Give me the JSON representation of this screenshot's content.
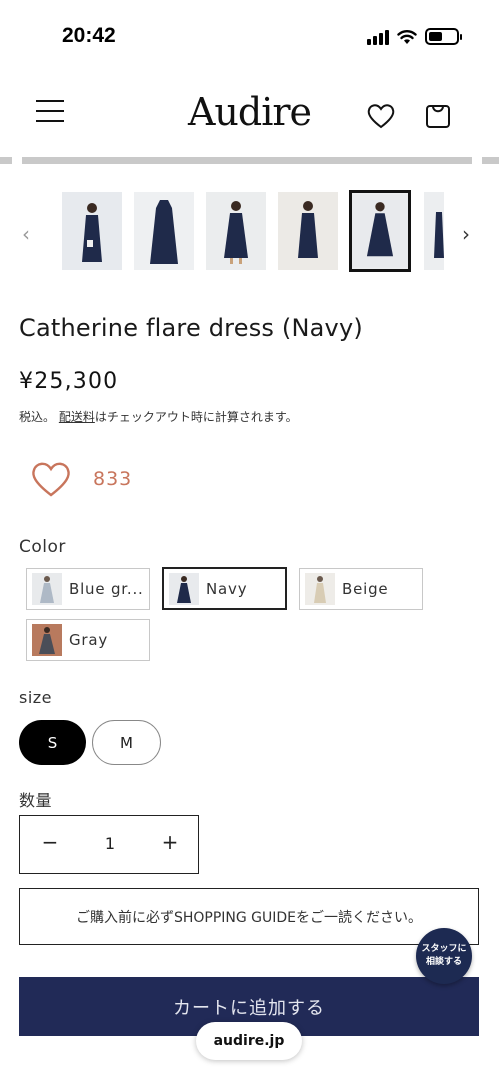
{
  "status_bar": {
    "time": "20:42"
  },
  "header": {
    "logo": "Audire"
  },
  "thumbnail_nav": {
    "prev": "‹",
    "next": "›"
  },
  "product": {
    "title": "Catherine flare dress (Navy)",
    "price": "¥25,300",
    "tax_prefix": "税込。",
    "shipping_link": "配送料",
    "tax_suffix": "はチェックアウト時に計算されます。",
    "favorite_count": "833"
  },
  "color": {
    "label": "Color",
    "options": [
      {
        "label": "Blue gr...",
        "color": "#aeb9c6"
      },
      {
        "label": "Navy",
        "color": "#1f2a4a"
      },
      {
        "label": "Beige",
        "color": "#d8ccb4"
      },
      {
        "label": "Gray",
        "color": "#4a4e58"
      }
    ],
    "selected": "Navy"
  },
  "size": {
    "label": "size",
    "options": [
      "S",
      "M"
    ],
    "selected": "S"
  },
  "quantity": {
    "label": "数量",
    "value": "1",
    "minus": "−",
    "plus": "+"
  },
  "guide_button": "ご購入前に必ずSHOPPING GUIDEをご一読ください。",
  "staff_button": {
    "line1": "スタッフに",
    "line2": "相談する"
  },
  "cart_button": "カートに追加する",
  "browser": {
    "url": "audire.jp"
  },
  "colors": {
    "accent": "#212a57",
    "favorite": "#c8755c"
  }
}
